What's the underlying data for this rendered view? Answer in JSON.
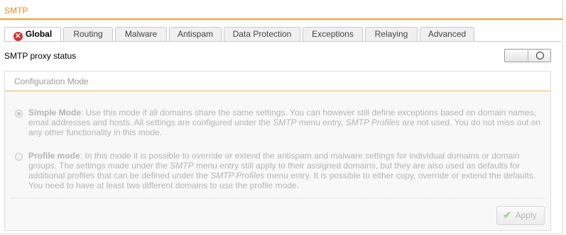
{
  "header": {
    "title": "SMTP"
  },
  "tabs": [
    {
      "label": "Global",
      "active": true,
      "icon": "error-icon"
    },
    {
      "label": "Routing"
    },
    {
      "label": "Malware"
    },
    {
      "label": "Antispam"
    },
    {
      "label": "Data Protection"
    },
    {
      "label": "Exceptions"
    },
    {
      "label": "Relaying"
    },
    {
      "label": "Advanced"
    }
  ],
  "proxy": {
    "label": "SMTP proxy status",
    "enabled": false
  },
  "config": {
    "title": "Configuration Mode",
    "simple": {
      "name": "Simple Mode",
      "t1": ": Use this mode if all domains share the same settings. You can however still define exceptions based on domain names, email addresses and hosts. All settings are configured under the ",
      "i1": "SMTP",
      "t2": " menu entry, ",
      "i2": "SMTP Profiles",
      "t3": " are not used. You do not miss out on any other functionality in this mode.",
      "selected": true
    },
    "profile": {
      "name": "Profile mode",
      "t1": ": In this mode it is possible to override or extend the antispam and malware settings for individual domains or domain groups. The settings made under the ",
      "i1": "SMTP",
      "t2": " menu entry still apply to their assigned domains, but they are also used as defaults for additional profiles that can be defined under the ",
      "i2": "SMTP Profiles",
      "t3": " menu entry. It is possible to either copy, override or extend the defaults. You need to have at least two different domains to use the profile mode.",
      "selected": false
    },
    "apply_label": "Apply"
  }
}
